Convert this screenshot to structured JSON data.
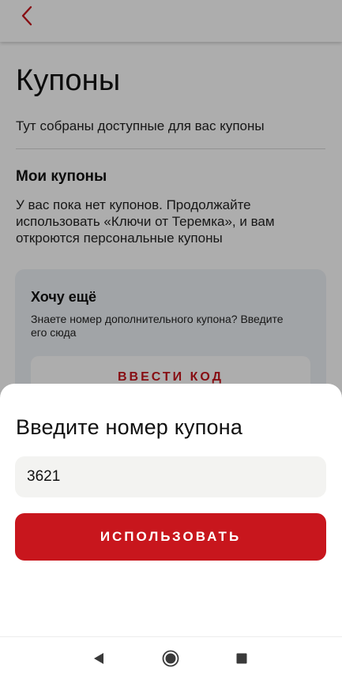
{
  "page": {
    "title": "Купоны",
    "subtitle": "Тут собраны доступные для вас купоны",
    "my_coupons_title": "Мои купоны",
    "empty_text": "У вас пока нет купонов. Продолжайте использовать «Ключи от Теремка», и вам откроются персональные купоны",
    "more_card": {
      "title": "Хочу ещё",
      "hint": "Знаете номер дополнительного купона? Введите его сюда",
      "enter_code_label": "ВВЕСТИ КОД"
    }
  },
  "sheet": {
    "title": "Введите номер купона",
    "input_value": "3621",
    "use_label": "ИСПОЛЬЗОВАТЬ"
  },
  "icons": {
    "back": "chevron-left-icon",
    "nav_back": "triangle-back-icon",
    "nav_home": "circle-home-icon",
    "nav_recents": "square-recents-icon"
  },
  "colors": {
    "brand_red": "#c8161d",
    "card_bg": "#eef2f6",
    "input_bg": "#f3f3f1"
  }
}
